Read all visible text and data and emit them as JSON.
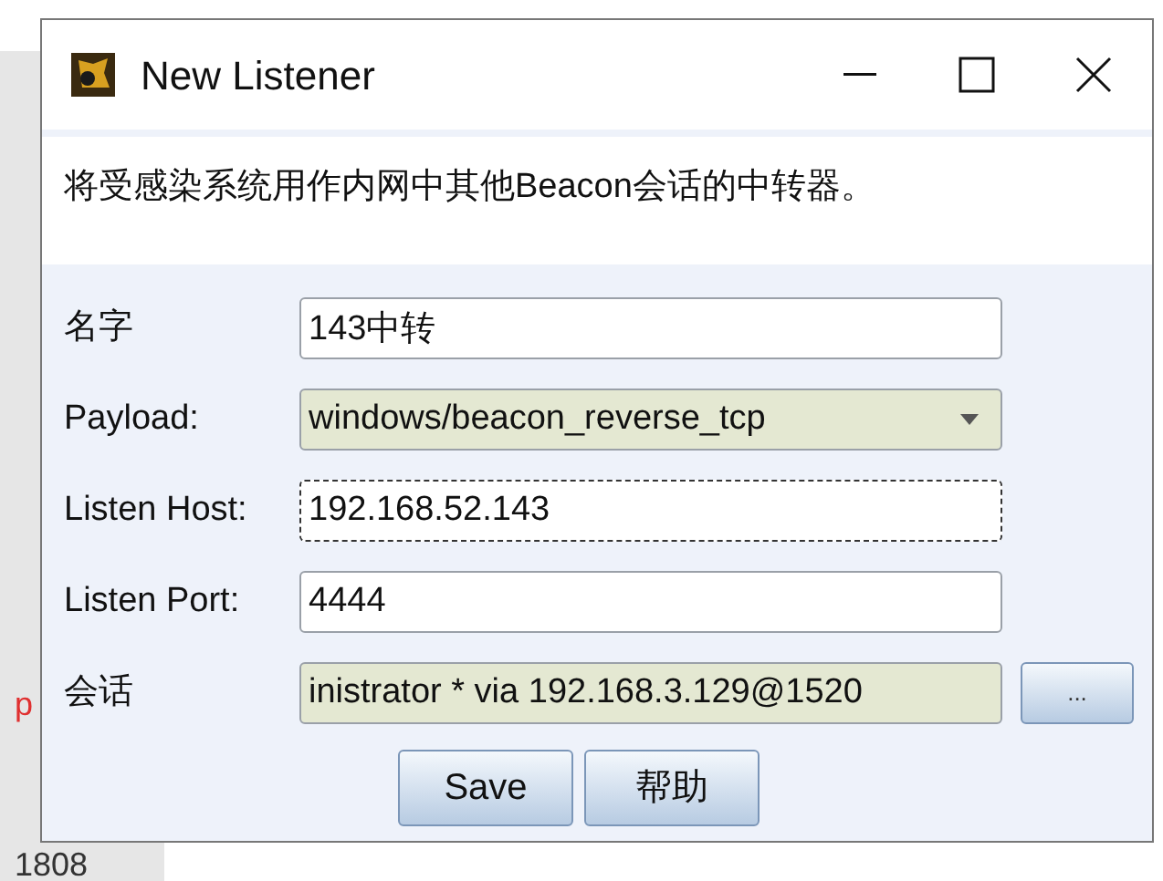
{
  "background": {
    "texts": [
      {
        "text": "p",
        "kind": "alert"
      },
      {
        "text": "1808",
        "kind": "plain"
      }
    ]
  },
  "window": {
    "title": "New Listener",
    "description": "将受感染系统用作内网中其他Beacon会话的中转器。"
  },
  "fields": [
    {
      "label": "名字",
      "kind": "text",
      "value": "143中转",
      "focused": false
    },
    {
      "label": "Payload:",
      "kind": "select",
      "value": "windows/beacon_reverse_tcp"
    },
    {
      "label": "Listen Host:",
      "kind": "text",
      "value": "192.168.52.143",
      "focused": true
    },
    {
      "label": "Listen Port:",
      "kind": "text",
      "value": "4444",
      "focused": false
    },
    {
      "label": "会话",
      "kind": "picker",
      "value": "inistrator * via  192.168.3.129@1520",
      "picker_button": "..."
    }
  ],
  "buttons": [
    "Save",
    "帮助"
  ]
}
